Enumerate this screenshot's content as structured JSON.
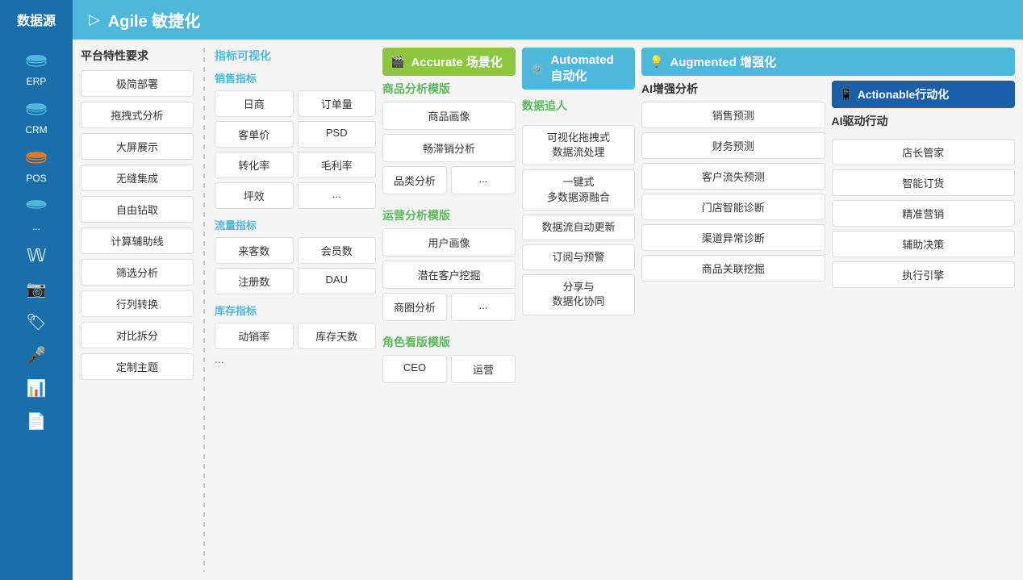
{
  "sidebar": {
    "title": "数据源",
    "items": [
      {
        "id": "erp",
        "label": "ERP",
        "icon": "database"
      },
      {
        "id": "crm",
        "label": "CRM",
        "icon": "database2"
      },
      {
        "id": "pos",
        "label": "POS",
        "icon": "database3"
      },
      {
        "id": "more",
        "label": "...",
        "icon": "database4"
      },
      {
        "id": "weibo",
        "label": "",
        "icon": "social"
      },
      {
        "id": "camera",
        "label": "",
        "icon": "camera"
      },
      {
        "id": "tag",
        "label": "",
        "icon": "tag"
      },
      {
        "id": "mic",
        "label": "",
        "icon": "mic"
      },
      {
        "id": "excel",
        "label": "",
        "icon": "excel"
      },
      {
        "id": "doc",
        "label": "",
        "icon": "doc"
      }
    ]
  },
  "header": {
    "icon": "▷",
    "title": "Agile 敏捷化"
  },
  "platform": {
    "title": "平台特性要求",
    "items": [
      "极简部署",
      "拖拽式分析",
      "大屏展示",
      "无缝集成",
      "自由钻取",
      "计算辅助线",
      "筛选分析",
      "行列转换",
      "对比拆分",
      "定制主题"
    ]
  },
  "metrics": {
    "title": "指标可视化",
    "sales": {
      "title": "销售指标",
      "items": [
        "日商",
        "订单量",
        "客单价",
        "PSD",
        "转化率",
        "毛利率",
        "坪效",
        "..."
      ]
    },
    "traffic": {
      "title": "流量指标",
      "items": [
        "来客数",
        "会员数",
        "注册数",
        "DAU"
      ]
    },
    "inventory": {
      "title": "库存指标",
      "items": [
        "动销率",
        "库存天数"
      ],
      "dots": "..."
    }
  },
  "accurate": {
    "banner": "Accurate 场景化",
    "goods_models": {
      "title": "商品分析模版",
      "items": [
        "商品画像",
        "畅滞销分析",
        "品类分析",
        "..."
      ]
    },
    "ops_models": {
      "title": "运营分析模版",
      "items": [
        "用户画像",
        "潜在客户挖掘",
        "商圈分析",
        "..."
      ]
    },
    "role_models": {
      "title": "角色看版模版",
      "items": [
        "CEO",
        "运营"
      ]
    }
  },
  "automated": {
    "banner": "Automated 自动化",
    "tracking": {
      "title": "数据追人",
      "items": [
        "可视化拖拽式\n数据流处理",
        "一键式\n多数据源融合",
        "数据流自动更新",
        "订阅与预警",
        "分享与\n数据化协同"
      ]
    }
  },
  "augmented": {
    "banner": "Augmented 增强化",
    "ai_analysis": {
      "title": "AI增强分析",
      "items": [
        "销售预测",
        "财务预测",
        "客户流失预测",
        "门店智能诊断",
        "渠道异常诊断",
        "商品关联挖掘"
      ]
    }
  },
  "actionable": {
    "banner": "Actionable行动化",
    "ai_drive": {
      "title": "AI驱动行动",
      "items": [
        "店长管家",
        "智能订货",
        "精准营销",
        "辅助决策",
        "执行引擎"
      ]
    }
  }
}
